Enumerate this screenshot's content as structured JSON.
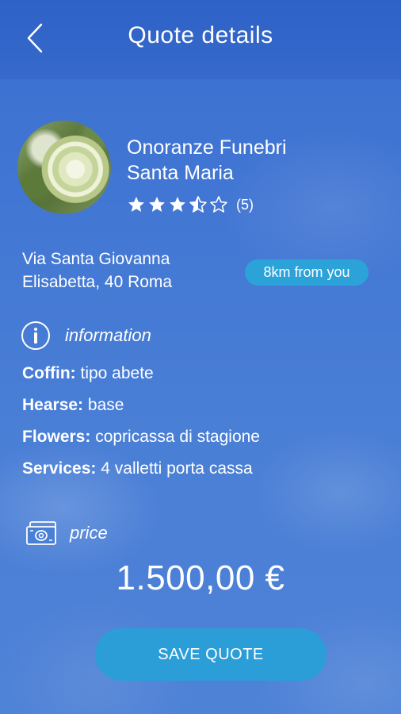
{
  "header": {
    "title": "Quote details",
    "back_icon": "chevron-left-icon"
  },
  "provider": {
    "name_line1": "Onoranze Funebri",
    "name_line2": "Santa Maria",
    "rating": 3.5,
    "rating_max": 5,
    "review_count": "(5)",
    "address_line1": "Via Santa Giovanna",
    "address_line2": "Elisabetta, 40 Roma",
    "distance": "8km from you"
  },
  "information": {
    "label": "information",
    "icon": "info-icon",
    "items": [
      {
        "key": "Coffin:",
        "value": "tipo abete"
      },
      {
        "key": "Hearse:",
        "value": "base"
      },
      {
        "key": "Flowers:",
        "value": "copricassa di stagione"
      },
      {
        "key": "Services:",
        "value": "4 valletti porta cassa"
      }
    ]
  },
  "price": {
    "label": "price",
    "icon": "banknote-icon",
    "amount": "1.500,00 €"
  },
  "actions": {
    "save_label": "SAVE QUOTE"
  },
  "colors": {
    "header_bg": "#3367ca",
    "accent": "#2b9ed8",
    "text": "#ffffff"
  }
}
